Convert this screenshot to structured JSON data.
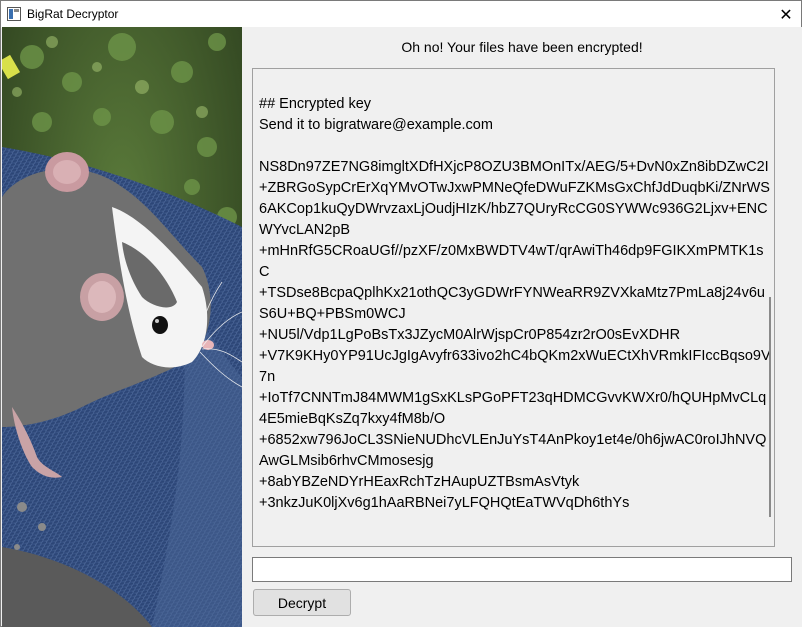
{
  "window": {
    "title": "BigRat Decryptor",
    "close_glyph": "✕"
  },
  "main": {
    "headline": "Oh no! Your files have been encrypted!",
    "key_text": "## Encrypted key\nSend it to bigratware@example.com\n\nNS8Dn97ZE7NG8imgltXDfHXjcP8OZU3BMOnITx/AEG/5+DvN0xZn8ibDZwC2I\n+ZBRGoSypCrErXqYMvOTwJxwPMNeQfeDWuFZKMsGxChfJdDuqbKi/ZNrWS6AKCop1kuQyDWrvzaxLjOudjHIzK/hbZ7QUryRcCG0SYWWc936G2Ljxv+ENCWYvcLAN2pB\n+mHnRfG5CRoaUGf//pzXF/z0MxBWDTV4wT/qrAwiTh46dp9FGIKXmPMTK1sC\n+TSDse8BcpaQplhKx21othQC3yGDWrFYNWeaRR9ZVXkaMtz7PmLa8j24v6uS6U+BQ+PBSm0WCJ\n+NU5l/Vdp1LgPoBsTx3JZycM0AlrWjspCr0P854zr2rO0sEvXDHR\n+V7K9KHy0YP91UcJgIgAvyfr633ivo2hC4bQKm2xWuECtXhVRmkIFIccBqso9V7n\n+IoTf7CNNTmJ84MWM1gSxKLsPGoPFT23qHDMCGvvKWXr0/hQUHpMvCLq4E5mieBqKsZq7kxy4fM8b/O\n+6852xw796JoCL3SNieNUDhcVLEnJuYsT4AnPkoy1et4e/0h6jwAC0roIJhNVQAwGLMsib6rhvCMmosesjg\n+8abYBZeNDYrHEaxRchTzHAupUZTBsmAsVtyk\n+3nkzJuK0ljXv6g1hAaRBNei7yLFQHQtEaTWVqDh6thYs",
    "input_value": "",
    "decrypt_label": "Decrypt"
  },
  "colors": {
    "background": "#f0f0f0",
    "titlebar": "#ffffff",
    "button": "#e1e1e1"
  },
  "icons": {
    "app": "app-icon",
    "close": "close-icon"
  }
}
